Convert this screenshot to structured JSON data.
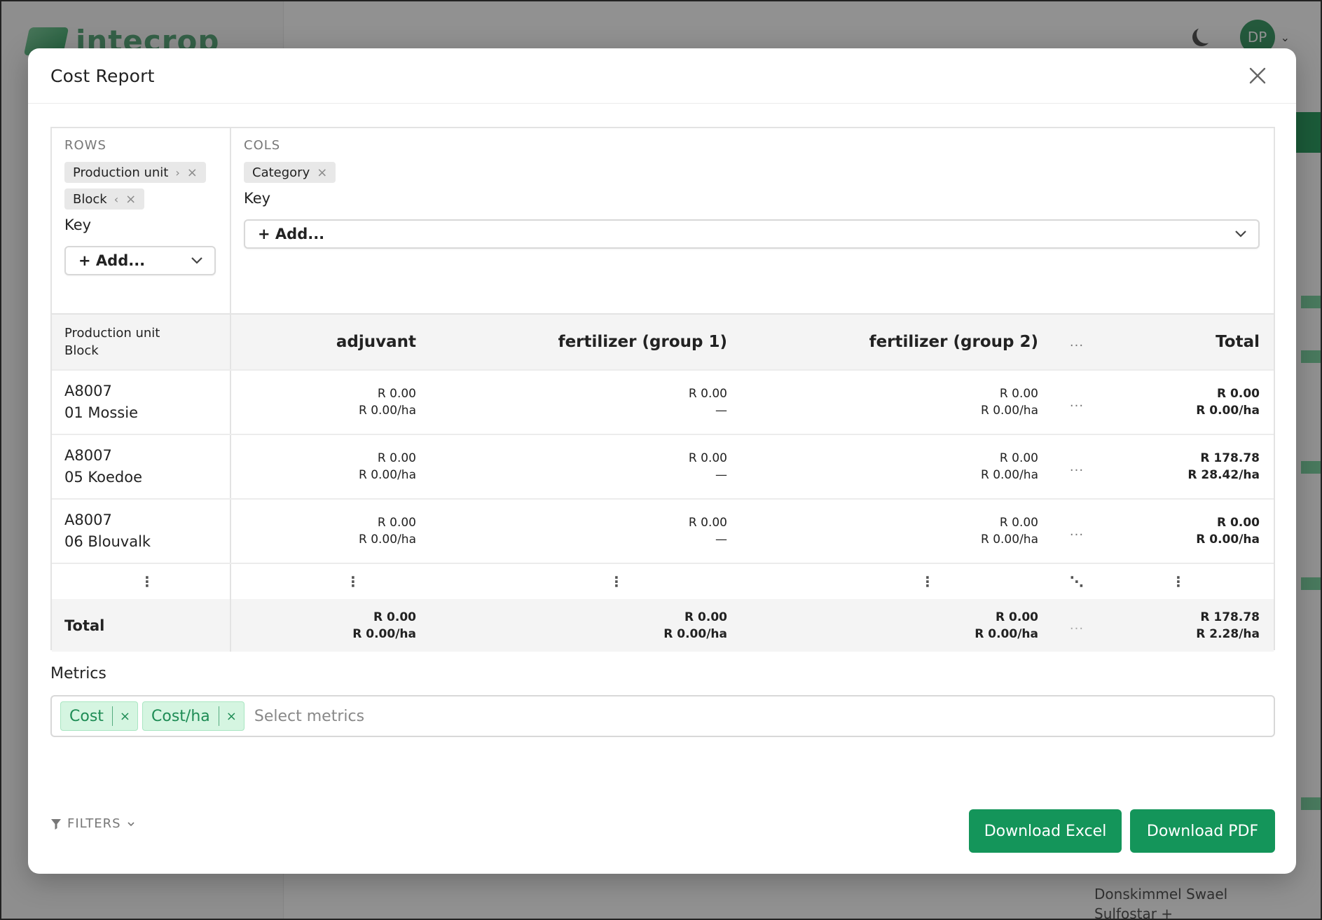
{
  "background": {
    "logo_text": "intecrop",
    "avatar_initials": "DP",
    "bottom_text_1": "Donskimmel Swael",
    "bottom_text_2": "Sulfostar +"
  },
  "modal": {
    "title": "Cost Report"
  },
  "pivot": {
    "rows_label": "ROWS",
    "cols_label": "COLS",
    "row_chips": [
      {
        "label": "Production unit",
        "arrow": "›"
      },
      {
        "label": "Block",
        "arrow": "‹"
      }
    ],
    "col_chips": [
      {
        "label": "Category"
      }
    ],
    "key_label": "Key",
    "add_label": "+ Add...",
    "remove_glyph": "×"
  },
  "table": {
    "row_header_lines": [
      "Production unit",
      "Block"
    ],
    "columns": [
      "adjuvant",
      "fertilizer (group 1)",
      "fertilizer (group 2)",
      "...",
      "Total"
    ],
    "rows": [
      {
        "unit": "A8007",
        "block": "01 Mossie",
        "adjuvant": [
          "R 0.00",
          "R 0.00/ha"
        ],
        "fert1": [
          "R 0.00",
          "—"
        ],
        "fert2": [
          "R 0.00",
          "R 0.00/ha"
        ],
        "more": "...",
        "total": [
          "R 0.00",
          "R 0.00/ha"
        ]
      },
      {
        "unit": "A8007",
        "block": "05 Koedoe",
        "adjuvant": [
          "R 0.00",
          "R 0.00/ha"
        ],
        "fert1": [
          "R 0.00",
          "—"
        ],
        "fert2": [
          "R 0.00",
          "R 0.00/ha"
        ],
        "more": "...",
        "total": [
          "R 178.78",
          "R 28.42/ha"
        ]
      },
      {
        "unit": "A8007",
        "block": "06 Blouvalk",
        "adjuvant": [
          "R 0.00",
          "R 0.00/ha"
        ],
        "fert1": [
          "R 0.00",
          "—"
        ],
        "fert2": [
          "R 0.00",
          "R 0.00/ha"
        ],
        "more": "...",
        "total": [
          "R 0.00",
          "R 0.00/ha"
        ]
      }
    ],
    "ellipsis_vertical": "⋮",
    "ellipsis_diagonal": "⋱",
    "total_row": {
      "label": "Total",
      "adjuvant": [
        "R 0.00",
        "R 0.00/ha"
      ],
      "fert1": [
        "R 0.00",
        "R 0.00/ha"
      ],
      "fert2": [
        "R 0.00",
        "R 0.00/ha"
      ],
      "more": "...",
      "total": [
        "R 178.78",
        "R 2.28/ha"
      ]
    }
  },
  "metrics": {
    "label": "Metrics",
    "tags": [
      "Cost",
      "Cost/ha"
    ],
    "placeholder": "Select metrics"
  },
  "filters": {
    "label": "FILTERS"
  },
  "buttons": {
    "excel": "Download Excel",
    "pdf": "Download PDF"
  },
  "colors": {
    "primary": "#14955a",
    "tag_bg": "#d5f5e1",
    "tag_text": "#1e8c55"
  }
}
